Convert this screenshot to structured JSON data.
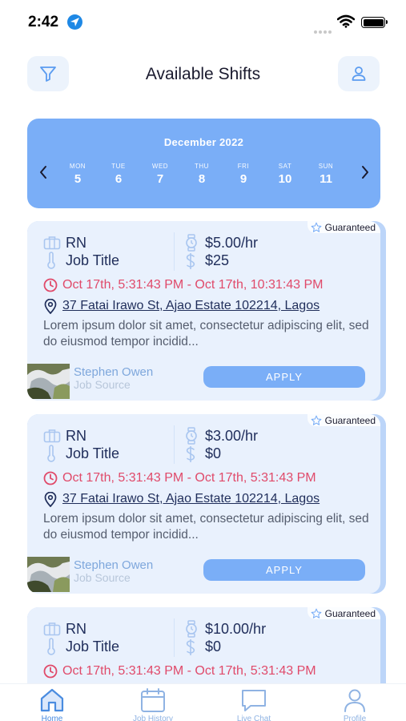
{
  "status_bar": {
    "time": "2:42"
  },
  "header": {
    "title": "Available Shifts"
  },
  "calendar": {
    "month": "December 2022",
    "days": [
      {
        "name": "MON",
        "num": "5"
      },
      {
        "name": "TUE",
        "num": "6"
      },
      {
        "name": "WED",
        "num": "7"
      },
      {
        "name": "THU",
        "num": "8"
      },
      {
        "name": "FRI",
        "num": "9"
      },
      {
        "name": "SAT",
        "num": "10"
      },
      {
        "name": "SUN",
        "num": "11"
      }
    ]
  },
  "shifts": [
    {
      "badge": "Guaranteed",
      "role": "RN",
      "job_title": "Job Title",
      "rate": "$5.00/hr",
      "total": "$25",
      "time_range": "Oct 17th, 5:31:43 PM - Oct 17th, 10:31:43 PM",
      "address": "37 Fatai Irawo St, Ajao Estate 102214, Lagos",
      "description": "Lorem ipsum dolor sit amet, consectetur adipiscing elit, sed do eiusmod tempor incidid...",
      "person_name": "Stephen Owen",
      "person_source": "Job Source",
      "apply_label": "APPLY"
    },
    {
      "badge": "Guaranteed",
      "role": "RN",
      "job_title": "Job Title",
      "rate": "$3.00/hr",
      "total": "$0",
      "time_range": "Oct 17th, 5:31:43 PM - Oct 17th, 5:31:43 PM",
      "address": "37 Fatai Irawo St, Ajao Estate 102214, Lagos",
      "description": "Lorem ipsum dolor sit amet, consectetur adipiscing elit, sed do eiusmod tempor incidid...",
      "person_name": "Stephen Owen",
      "person_source": "Job Source",
      "apply_label": "APPLY"
    },
    {
      "badge": "Guaranteed",
      "role": "RN",
      "job_title": "Job Title",
      "rate": "$10.00/hr",
      "total": "$0",
      "time_range": "Oct 17th, 5:31:43 PM - Oct 17th, 5:31:43 PM"
    }
  ],
  "tab_bar": {
    "tabs": [
      {
        "label": "Home",
        "icon": "home-icon",
        "active": true
      },
      {
        "label": "Job History",
        "icon": "calendar-icon",
        "active": false
      },
      {
        "label": "Live Chat",
        "icon": "chat-icon",
        "active": false
      },
      {
        "label": "Profile",
        "icon": "person-icon",
        "active": false
      }
    ]
  },
  "colors": {
    "accent": "#7aaef7",
    "card_bg": "#e9f1fd",
    "time_red": "#e04a6a",
    "text_navy": "#1f2d5a"
  }
}
